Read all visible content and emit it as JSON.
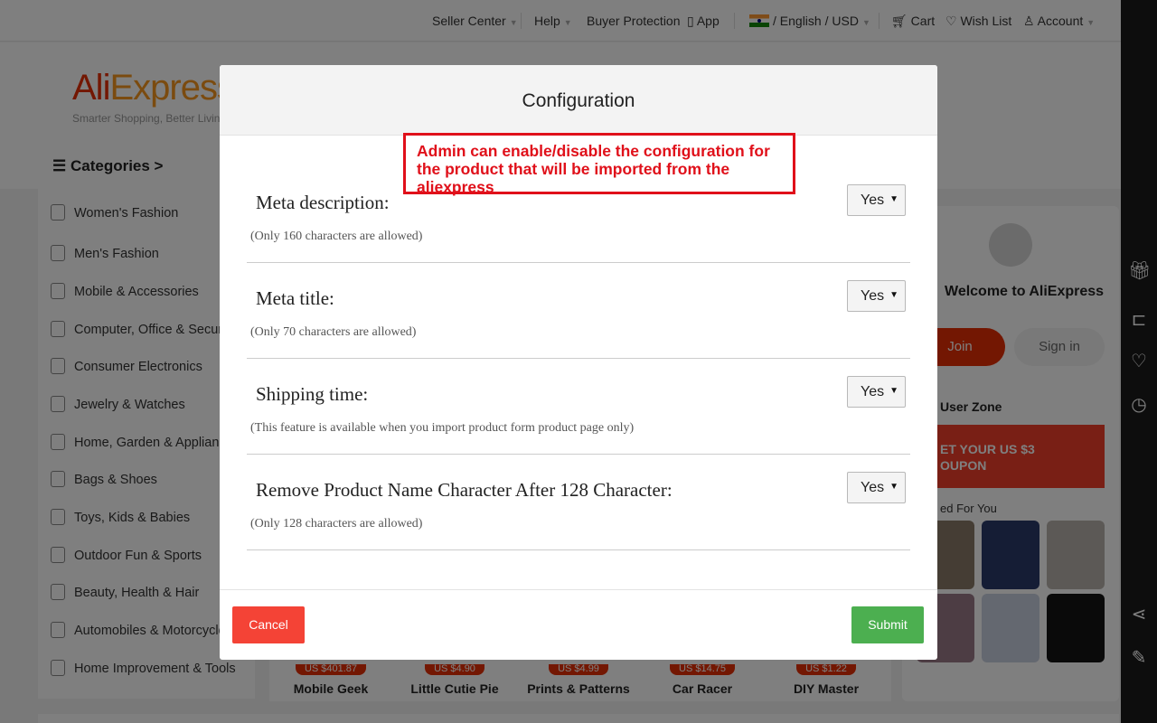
{
  "topbar": {
    "seller_center": "Seller Center",
    "help": "Help",
    "buyer_protection": "Buyer Protection",
    "app": "App",
    "locale": "/ English /  USD",
    "cart": "Cart",
    "wish_list": "Wish List",
    "account": "Account"
  },
  "brand": {
    "logo_a": "Ali",
    "logo_b": "Express",
    "tagline": "Smarter Shopping, Better Living!"
  },
  "categories": {
    "title": "Categories >",
    "items": [
      "Women's Fashion",
      "Men's Fashion",
      "Mobile & Accessories",
      "Computer, Office & Security",
      "Consumer Electronics",
      "Jewelry & Watches",
      "Home, Garden & Appliances",
      "Bags & Shoes",
      "Toys, Kids & Babies",
      "Outdoor Fun & Sports",
      "Beauty, Health & Hair",
      "Automobiles & Motorcycles",
      "Home Improvement & Tools"
    ]
  },
  "right_panel": {
    "welcome": "Welcome to AliExpress",
    "join": "Join",
    "sign_in": "Sign in",
    "user_zone": "User Zone",
    "coupon_line1": "ET YOUR US $3",
    "coupon_line2": "OUPON",
    "picked": "ed For You"
  },
  "tiles": [
    {
      "price": "US $401.87",
      "name": "Mobile Geek"
    },
    {
      "price": "US $4.90",
      "name": "Little Cutie Pie"
    },
    {
      "price": "US $4.99",
      "name": "Prints & Patterns"
    },
    {
      "price": "US $14.75",
      "name": "Car Racer"
    },
    {
      "price": "US $1.22",
      "name": "DIY Master"
    }
  ],
  "modal": {
    "title": "Configuration",
    "annotation": "Admin can enable/disable the configuration for the product that will be imported from the aliexpress",
    "rows": [
      {
        "label": "Meta description:",
        "hint": "(Only 160 characters are allowed)",
        "value": "Yes"
      },
      {
        "label": "Meta title:",
        "hint": "(Only 70 characters are allowed)",
        "value": "Yes"
      },
      {
        "label": "Shipping time:",
        "hint": "(This feature is available when you import product form product page only)",
        "value": "Yes"
      },
      {
        "label": "Remove Product Name Character After 128 Character:",
        "hint": "(Only 128 characters are allowed)",
        "value": "Yes"
      }
    ],
    "cancel": "Cancel",
    "submit": "Submit"
  },
  "colors": {
    "brand_red": "#e62e04",
    "annotation_red": "#e0101a",
    "cancel": "#f44336",
    "submit": "#4caf50"
  }
}
